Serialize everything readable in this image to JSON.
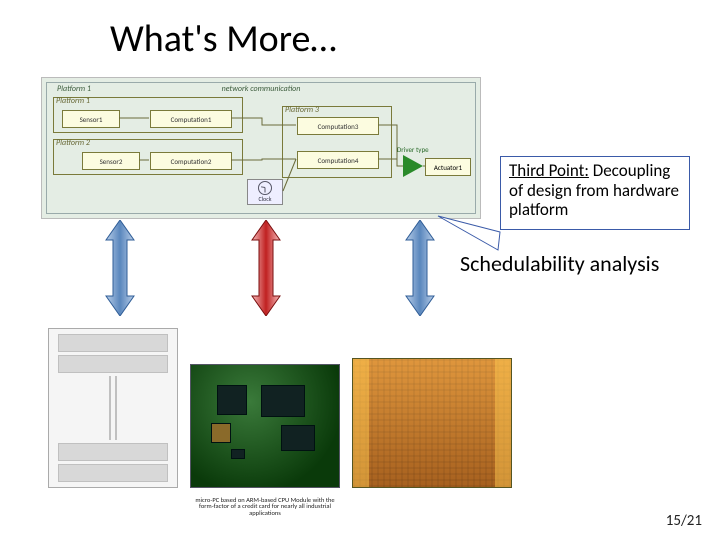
{
  "title": "What's More…",
  "diagram": {
    "top_left_label": "Platform 1",
    "top_center_label": "network communication",
    "platforms": {
      "p1": "Platform 1",
      "p2": "Platform 2",
      "p3": "Platform 3"
    },
    "blocks": {
      "sensor1": "Sensor1",
      "comp1": "Computation1",
      "sensor2": "Sensor2",
      "comp2": "Computation2",
      "comp3": "Computation3",
      "comp4": "Computation4"
    },
    "clock_label": "Clock",
    "amp_label": "Driver type",
    "actuator": "Actuator1"
  },
  "callout": {
    "lead": "Third Point:",
    "rest": " Decoupling of design from hardware platform"
  },
  "sched": "Schedulability analysis",
  "hw2_caption": "micro-PC based on ARM-based CPU Module with the form-factor of a credit card for nearly all industrial applications",
  "page": "15/21"
}
